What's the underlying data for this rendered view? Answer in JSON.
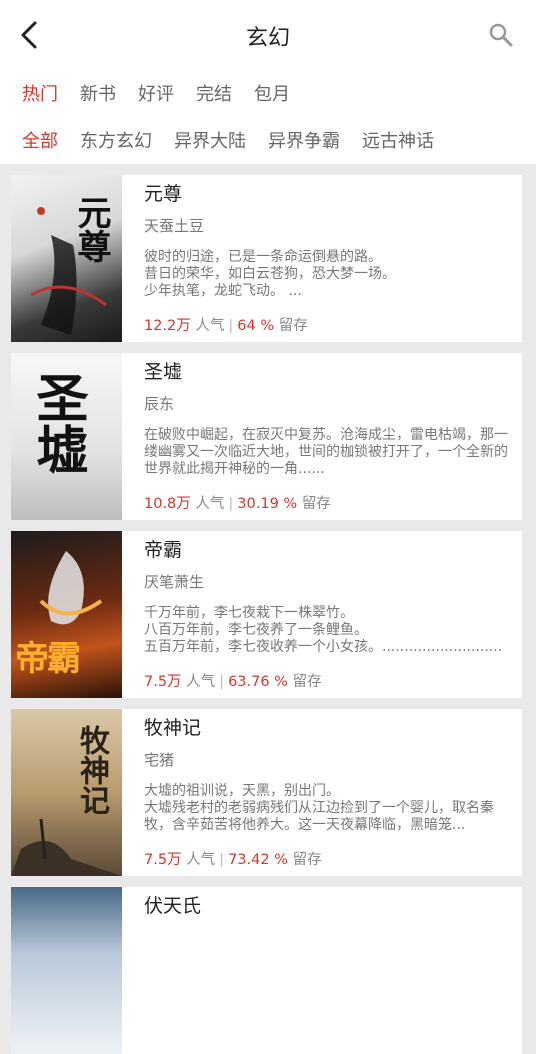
{
  "header": {
    "title": "玄幻"
  },
  "tabs_primary": [
    "热门",
    "新书",
    "好评",
    "完结",
    "包月"
  ],
  "tabs_secondary": [
    "全部",
    "东方玄幻",
    "异界大陆",
    "异界争霸",
    "远古神话"
  ],
  "labels": {
    "popularity": "人气",
    "retention": "留存"
  },
  "books": [
    {
      "title": "元尊",
      "author": "天蚕土豆",
      "desc": "彼时的归途，已是一条命运倒悬的路。\n昔日的荣华，如白云苍狗，恐大梦一场。\n少年执笔，龙蛇飞动。 ...",
      "popularity": "12.2万",
      "retention": "64 %",
      "cover_text": "元尊"
    },
    {
      "title": "圣墟",
      "author": "辰东",
      "desc": "在破败中崛起，在寂灭中复苏。沧海成尘，雷电枯竭，那一缕幽雾又一次临近大地，世间的枷锁被打开了，一个全新的世界就此揭开神秘的一角......",
      "popularity": "10.8万",
      "retention": "30.19 %",
      "cover_text": "圣墟"
    },
    {
      "title": "帝霸",
      "author": "厌笔萧生",
      "desc": "千万年前，李七夜栽下一株翠竹。\n八百万年前，李七夜养了一条鲤鱼。\n五百万年前，李七夜收养一个小女孩。...........................",
      "popularity": "7.5万",
      "retention": "63.76 %",
      "cover_text": "帝霸"
    },
    {
      "title": "牧神记",
      "author": "宅猪",
      "desc": "大墟的祖训说，天黑，别出门。\n大墟残老村的老弱病残们从江边捡到了一个婴儿，取名秦牧，含辛茹苦将他养大。这一天夜幕降临，黑暗笼...",
      "popularity": "7.5万",
      "retention": "73.42 %",
      "cover_text": "牧神记"
    },
    {
      "title": "伏天氏",
      "author": "",
      "desc": "",
      "popularity": "",
      "retention": "",
      "cover_text": ""
    }
  ]
}
